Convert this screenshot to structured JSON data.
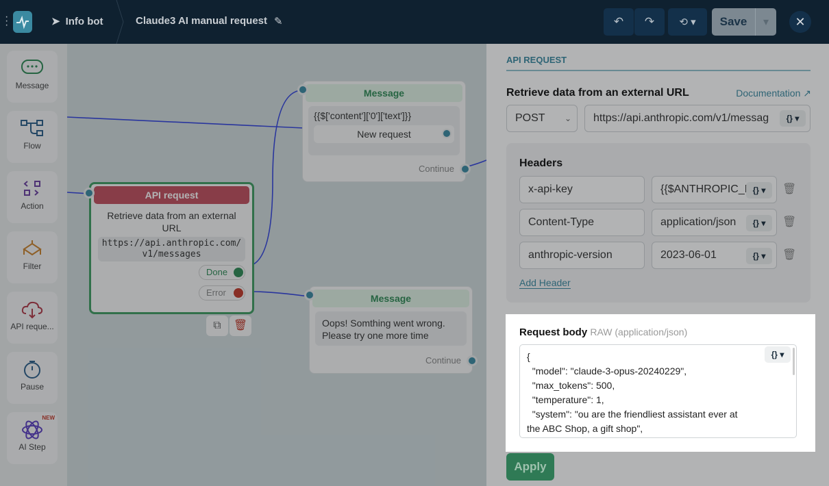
{
  "header": {
    "bot_name": "Info bot",
    "flow_title": "Claude3 AI manual request",
    "save_label": "Save"
  },
  "sidebar": {
    "items": [
      {
        "label": "Message"
      },
      {
        "label": "Flow"
      },
      {
        "label": "Action"
      },
      {
        "label": "Filter"
      },
      {
        "label": "API reque..."
      },
      {
        "label": "Pause"
      },
      {
        "label": "AI Step",
        "badge": "NEW"
      }
    ]
  },
  "canvas": {
    "message1": {
      "title": "Message",
      "text": "{{$['content']['0']['text']}}",
      "button": "New request",
      "continue": "Continue"
    },
    "api_node": {
      "title": "API request",
      "desc": "Retrieve data from an external URL",
      "url": "https://api.anthropic.com/v1/messages",
      "done": "Done",
      "error": "Error"
    },
    "message2": {
      "title": "Message",
      "text": "Oops! Somthing went wrong. Please try one more time",
      "continue": "Continue"
    }
  },
  "panel": {
    "section": "API REQUEST",
    "heading": "Retrieve data from an external URL",
    "doc_link": "Documentation",
    "method": "POST",
    "url": "https://api.anthropic.com/v1/messag",
    "headers_title": "Headers",
    "headers": [
      {
        "key": "x-api-key",
        "value": "{{$ANTHROPIC_K"
      },
      {
        "key": "Content-Type",
        "value": "application/json"
      },
      {
        "key": "anthropic-version",
        "value": "2023-06-01"
      }
    ],
    "add_header": "Add Header",
    "body_title": "Request body",
    "body_type": "RAW (application/json)",
    "body_text": "{\n  \"model\": \"claude-3-opus-20240229\",\n  \"max_tokens\": 500,\n  \"temperature\": 1,\n  \"system\": \"ou are the friendliest assistant ever at the ABC Shop, a gift shop\",",
    "apply": "Apply"
  },
  "colors": {
    "accent": "#3b8aa1",
    "api_header": "#c0505e",
    "done": "#2f8a55",
    "error": "#c0392b"
  }
}
